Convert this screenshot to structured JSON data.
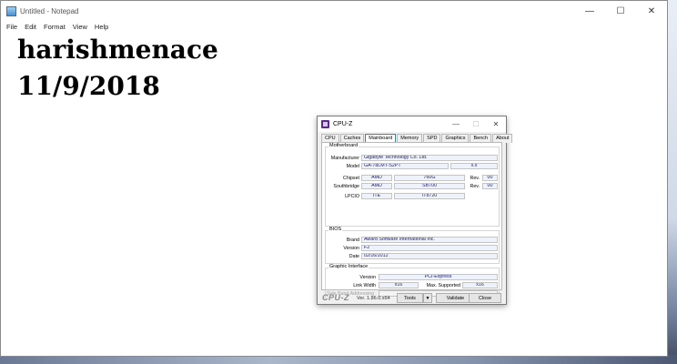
{
  "notepad": {
    "title": "Untitled - Notepad",
    "menu": [
      "File",
      "Edit",
      "Format",
      "View",
      "Help"
    ],
    "lines": [
      "harishmenace",
      "11/9/2018"
    ]
  },
  "cpuz": {
    "title": "CPU-Z",
    "tabs": [
      "CPU",
      "Caches",
      "Mainboard",
      "Memory",
      "SPD",
      "Graphics",
      "Bench",
      "About"
    ],
    "active_tab": "Mainboard",
    "motherboard": {
      "group_title": "Motherboard",
      "manufacturer_label": "Manufacturer",
      "manufacturer": "Gigabyte Technology Co. Ltd.",
      "model_label": "Model",
      "model": "GA-78LMT-S2PT",
      "model_rev": "x.x",
      "chipset_label": "Chipset",
      "chipset_vendor": "AMD",
      "chipset_model": "760G",
      "rev_label": "Rev.",
      "chipset_rev": "00",
      "southbridge_label": "Southbridge",
      "southbridge_vendor": "AMD",
      "southbridge_model": "SB700",
      "southbridge_rev": "00",
      "lpcio_label": "LPCIO",
      "lpcio_vendor": "ITE",
      "lpcio_model": "IT8720"
    },
    "bios": {
      "group_title": "BIOS",
      "brand_label": "Brand",
      "brand": "Award Software International Inc.",
      "version_label": "Version",
      "version": "F2",
      "date_label": "Date",
      "date": "02/16/2012"
    },
    "graphic_interface": {
      "group_title": "Graphic Interface",
      "version_label": "Version",
      "version": "PCI-Express",
      "link_width_label": "Link Width",
      "link_width": "x16",
      "max_supported_label": "Max. Supported",
      "max_supported": "x16",
      "side_band_label": "Side Band Addressing"
    },
    "footer": {
      "logo": "CPU-Z",
      "version": "Ver. 1.86.0.x64",
      "tools_label": "Tools",
      "validate_label": "Validate",
      "close_label": "Close"
    }
  }
}
